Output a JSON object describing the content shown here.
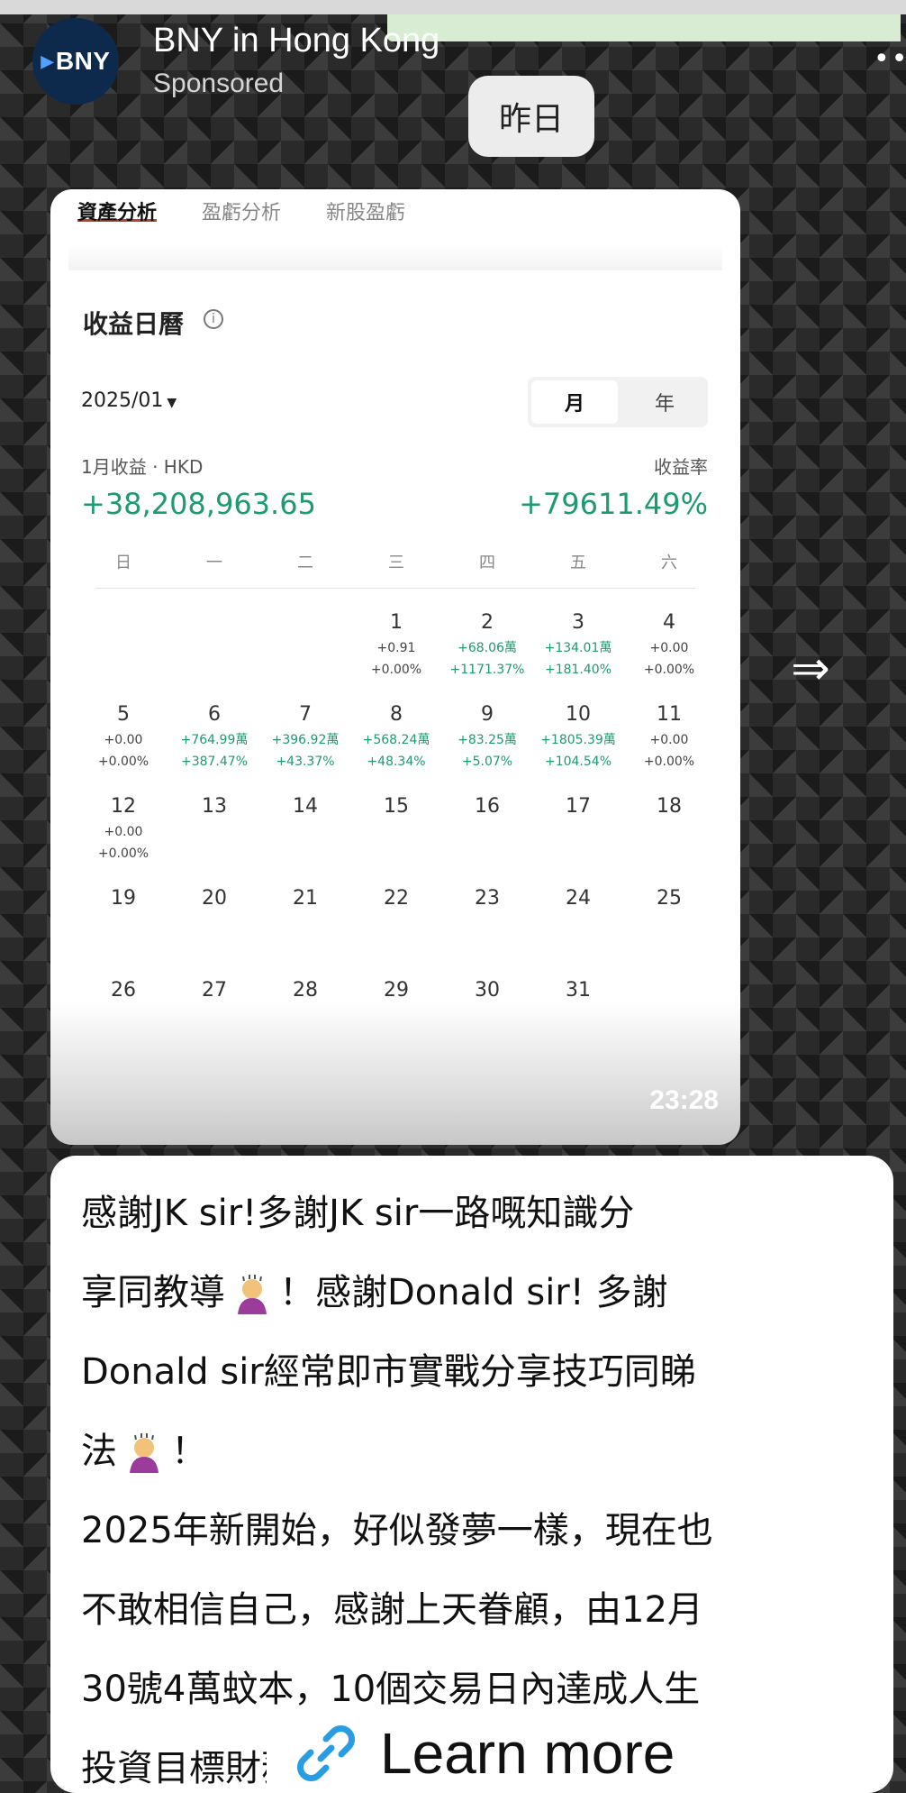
{
  "ad": {
    "brand_logo_text": "BNY",
    "brand_name": "BNY in Hong Kong",
    "sponsored": "Sponsored",
    "cta_label": "Learn more"
  },
  "chat": {
    "date_chip": "昨日",
    "image_timestamp": "23:28"
  },
  "screenshot": {
    "tabs": [
      "資產分析",
      "盈虧分析",
      "新股盈虧"
    ],
    "title": "收益日曆",
    "month": "2025/01",
    "segments": [
      "月",
      "年"
    ],
    "summary_label": "1月收益 · HKD",
    "summary_value": "+38,208,963.65",
    "rate_label": "收益率",
    "rate_value": "+79611.49%",
    "weekdays": [
      "日",
      "一",
      "二",
      "三",
      "四",
      "五",
      "六"
    ],
    "days": [
      {
        "d": "1",
        "a": "+0.91",
        "r": "+0.00%"
      },
      {
        "d": "2",
        "a": "+68.06萬",
        "r": "+1171.37%"
      },
      {
        "d": "3",
        "a": "+134.01萬",
        "r": "+181.40%"
      },
      {
        "d": "4",
        "a": "+0.00",
        "r": "+0.00%"
      },
      {
        "d": "5",
        "a": "+0.00",
        "r": "+0.00%"
      },
      {
        "d": "6",
        "a": "+764.99萬",
        "r": "+387.47%"
      },
      {
        "d": "7",
        "a": "+396.92萬",
        "r": "+43.37%"
      },
      {
        "d": "8",
        "a": "+568.24萬",
        "r": "+48.34%"
      },
      {
        "d": "9",
        "a": "+83.25萬",
        "r": "+5.07%"
      },
      {
        "d": "10",
        "a": "+1805.39萬",
        "r": "+104.54%"
      },
      {
        "d": "11",
        "a": "+0.00",
        "r": "+0.00%"
      },
      {
        "d": "12",
        "a": "+0.00",
        "r": "+0.00%"
      },
      {
        "d": "13",
        "a": "",
        "r": ""
      },
      {
        "d": "14",
        "a": "",
        "r": ""
      },
      {
        "d": "15",
        "a": "",
        "r": ""
      },
      {
        "d": "16",
        "a": "",
        "r": ""
      },
      {
        "d": "17",
        "a": "",
        "r": ""
      },
      {
        "d": "18",
        "a": "",
        "r": ""
      },
      {
        "d": "19",
        "a": "",
        "r": ""
      },
      {
        "d": "20",
        "a": "",
        "r": ""
      },
      {
        "d": "21",
        "a": "",
        "r": ""
      },
      {
        "d": "22",
        "a": "",
        "r": ""
      },
      {
        "d": "23",
        "a": "",
        "r": ""
      },
      {
        "d": "24",
        "a": "",
        "r": ""
      },
      {
        "d": "25",
        "a": "",
        "r": ""
      },
      {
        "d": "26",
        "a": "",
        "r": ""
      },
      {
        "d": "27",
        "a": "",
        "r": ""
      },
      {
        "d": "28",
        "a": "",
        "r": ""
      },
      {
        "d": "29",
        "a": "",
        "r": ""
      },
      {
        "d": "30",
        "a": "",
        "r": ""
      },
      {
        "d": "31",
        "a": "",
        "r": ""
      }
    ]
  },
  "message": {
    "line1": "感謝JK sir!多謝JK sir一路嘅知識分",
    "line2a": "享同教導",
    "line2b": "！感謝Donald sir! 多謝",
    "line3": "Donald sir經常即市實戰分享技巧同睇",
    "line4a": "法",
    "line4b": "！",
    "line5": "2025年新開始，好似發夢一樣，現在也",
    "line6": "不敢相信自己，感謝上天眷顧，由12月",
    "line7": "30號4萬蚊本，10個交易日內達成人生",
    "line8": "投資目標財務自由"
  },
  "colors": {
    "gain_green": "#1f9a6f",
    "logo_navy": "#0d2a4d"
  }
}
